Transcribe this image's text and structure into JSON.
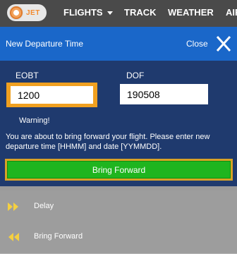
{
  "brand": {
    "logo_text": "JET",
    "accent": "#f28a2e"
  },
  "nav": {
    "flights": "FLIGHTS",
    "track": "TRACK",
    "weather": "WEATHER",
    "more": "AIR"
  },
  "dialog": {
    "title": "New Departure Time",
    "close_label": "Close",
    "eobt_label": "EOBT",
    "eobt_value": "1200",
    "dof_label": "DOF",
    "dof_value": "190508",
    "warning_title": "Warning!",
    "warning_text": "You are about to bring forward your flight. Please enter new departure time [HHMM] and date [YYMMDD].",
    "confirm_label": "Bring Forward",
    "confirm_color": "#1fb51f",
    "highlight_color": "#f0a020"
  },
  "menu": {
    "items": [
      {
        "label": "Delay",
        "icon": "fast-forward-icon"
      },
      {
        "label": "Bring Forward",
        "icon": "rewind-icon"
      }
    ]
  }
}
